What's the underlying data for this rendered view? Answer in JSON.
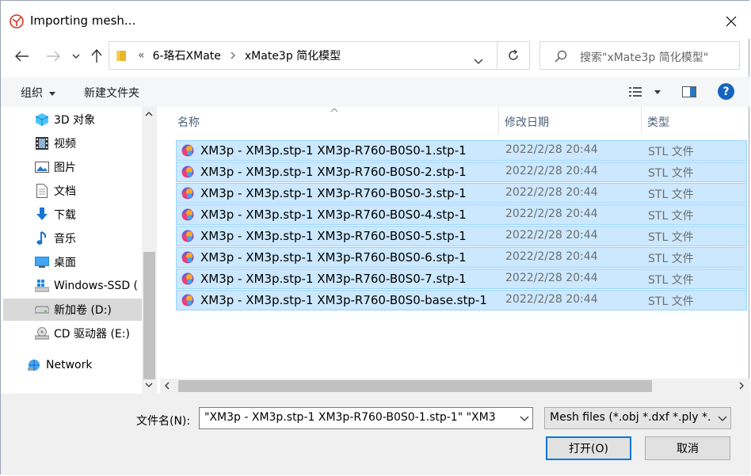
{
  "window": {
    "title": "Importing mesh..."
  },
  "address": {
    "overflow": "«",
    "crumbs": [
      "6-珞石XMate",
      "xMate3p 简化模型"
    ]
  },
  "search": {
    "placeholder": "搜索\"xMate3p 简化模型\""
  },
  "toolbar": {
    "organize": "组织",
    "new_folder": "新建文件夹"
  },
  "nav": {
    "items": [
      {
        "label": "3D 对象",
        "icon": "3d-objects-icon"
      },
      {
        "label": "视频",
        "icon": "video-icon"
      },
      {
        "label": "图片",
        "icon": "pictures-icon"
      },
      {
        "label": "文档",
        "icon": "documents-icon"
      },
      {
        "label": "下载",
        "icon": "download-icon"
      },
      {
        "label": "音乐",
        "icon": "music-icon"
      },
      {
        "label": "桌面",
        "icon": "desktop-icon"
      },
      {
        "label": "Windows-SSD (",
        "icon": "windows-drive-icon"
      },
      {
        "label": "新加卷 (D:)",
        "icon": "drive-icon",
        "selected": true
      },
      {
        "label": "CD 驱动器 (E:)",
        "icon": "cd-drive-icon"
      },
      {
        "label": "Network",
        "icon": "network-icon"
      }
    ]
  },
  "columns": {
    "name": "名称",
    "date": "修改日期",
    "type": "类型"
  },
  "files": [
    {
      "name": "XM3p - XM3p.stp-1 XM3p-R760-B0S0-1.stp-1",
      "date": "2022/2/28 20:44",
      "type": "STL 文件"
    },
    {
      "name": "XM3p - XM3p.stp-1 XM3p-R760-B0S0-2.stp-1",
      "date": "2022/2/28 20:44",
      "type": "STL 文件"
    },
    {
      "name": "XM3p - XM3p.stp-1 XM3p-R760-B0S0-3.stp-1",
      "date": "2022/2/28 20:44",
      "type": "STL 文件"
    },
    {
      "name": "XM3p - XM3p.stp-1 XM3p-R760-B0S0-4.stp-1",
      "date": "2022/2/28 20:44",
      "type": "STL 文件"
    },
    {
      "name": "XM3p - XM3p.stp-1 XM3p-R760-B0S0-5.stp-1",
      "date": "2022/2/28 20:44",
      "type": "STL 文件"
    },
    {
      "name": "XM3p - XM3p.stp-1 XM3p-R760-B0S0-6.stp-1",
      "date": "2022/2/28 20:44",
      "type": "STL 文件"
    },
    {
      "name": "XM3p - XM3p.stp-1 XM3p-R760-B0S0-7.stp-1",
      "date": "2022/2/28 20:44",
      "type": "STL 文件"
    },
    {
      "name": "XM3p - XM3p.stp-1 XM3p-R760-B0S0-base.stp-1",
      "date": "2022/2/28 20:44",
      "type": "STL 文件"
    }
  ],
  "bottom": {
    "filename_label": "文件名(N):",
    "filename_value": "\"XM3p - XM3p.stp-1 XM3p-R760-B0S0-1.stp-1\" \"XM3",
    "filter_value": "Mesh files (*.obj *.dxf *.ply *.",
    "open_label": "打开(O)",
    "cancel_label": "取消"
  },
  "colors": {
    "selection_bg": "#cce8ff",
    "selection_border": "#99d1ff",
    "accent": "#0078d7"
  }
}
